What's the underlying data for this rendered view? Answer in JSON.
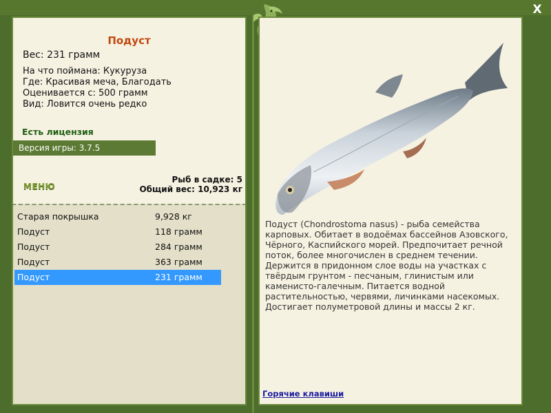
{
  "window": {
    "close_label": "X"
  },
  "fish": {
    "name": "Подуст",
    "weight": "Вес: 231 грамм",
    "bait": "На что поймана: Кукуруза",
    "location": "Где: Красивая меча, Благодать",
    "value": "Оценивается с: 500 грамм",
    "rarity": "Вид: Ловится очень редко",
    "description": "Подуст (Chondrostoma nasus) - рыба семейства карповых. Обитает в водоёмах бассейнов Азовского, Чёрного, Каспийского морей. Предпочитает речной поток, более многочислен в среднем течении. Держится в придонном слое воды на участках с твёрдым грунтом - песчаным, глинистым или каменисто-галечным. Питается водной растительностью, червями, личинками насекомых. Достигает полуметровой длины и массы 2 кг."
  },
  "license": "Есть лицензия",
  "version": "Версия игры: 3.7.5",
  "menu_label": "МЕНЮ",
  "keepnet": {
    "count": "Рыб в садке: 5",
    "total": "Общий вес: 10,923 кг"
  },
  "catches": [
    {
      "name": "Старая покрышка",
      "weight": "9,928 кг"
    },
    {
      "name": "Подуст",
      "weight": "118 грамм"
    },
    {
      "name": "Подуст",
      "weight": "284 грамм"
    },
    {
      "name": "Подуст",
      "weight": "363 грамм"
    },
    {
      "name": "Подуст",
      "weight": "231 грамм"
    }
  ],
  "selected_catch_index": 4,
  "hotkeys_label": "Горячие клавиши",
  "colors": {
    "frame": "#4d6d2c",
    "panel": "#f6f2e2",
    "accent_title": "#c0480e",
    "selection": "#3399ff"
  }
}
